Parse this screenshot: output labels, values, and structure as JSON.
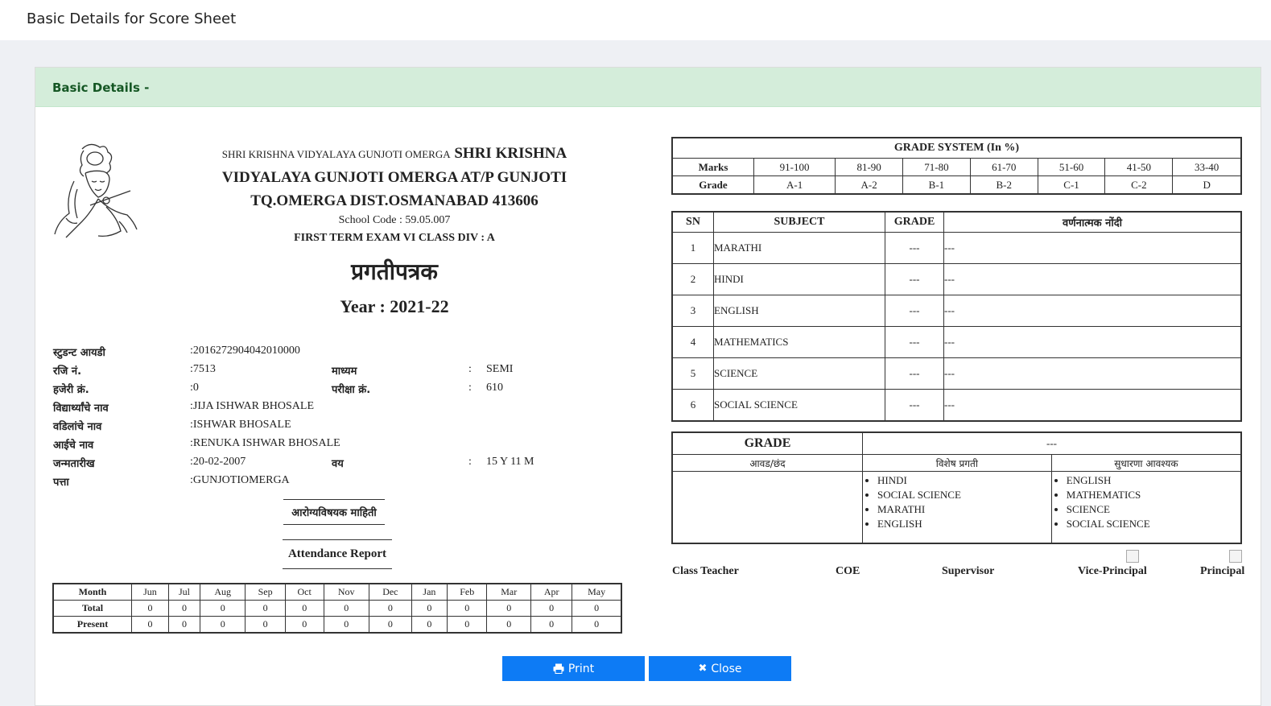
{
  "page": {
    "title": "Basic Details for Score Sheet"
  },
  "card": {
    "header": "Basic Details -"
  },
  "school": {
    "line1_small": "SHRI KRISHNA VIDYALAYA GUNJOTI OMERGA",
    "line1_big": "SHRI KRISHNA",
    "line2": "VIDYALAYA GUNJOTI OMERGA AT/P GUNJOTI",
    "line3": "TQ.OMERGA DIST.OSMANABAD 413606",
    "school_code": "School Code : 59.05.007",
    "exam": "FIRST TERM EXAM VI CLASS DIV : A",
    "report_title": "प्रगतीपत्रक",
    "year": "Year : 2021-22"
  },
  "student": {
    "rows": [
      {
        "label": "स्टुडन्ट आयडी",
        "value": ":2016272904042010000"
      },
      {
        "label": "रजि नं.",
        "value": ":7513",
        "label2": "माध्यम",
        "value2": "SEMI"
      },
      {
        "label": "हजेरी क्रं.",
        "value": ":0",
        "label2": "परीक्षा क्रं.",
        "value2": "610"
      },
      {
        "label": "विद्यार्थ्यांचे नाव",
        "value": ":JIJA ISHWAR BHOSALE"
      },
      {
        "label": "वडिलांचे नाव",
        "value": ":ISHWAR BHOSALE"
      },
      {
        "label": "आईचे नाव",
        "value": ":RENUKA ISHWAR BHOSALE"
      },
      {
        "label": "जन्मतारीख",
        "value": ":20-02-2007",
        "label2": "वय",
        "value2": "15 Y 11 M"
      },
      {
        "label": "पत्ता",
        "value": ":GUNJOTIOMERGA"
      }
    ],
    "colon": ":"
  },
  "health": {
    "title": "आरोग्यविषयक माहिती"
  },
  "attendance": {
    "title": "Attendance Report",
    "month_label": "Month",
    "total_label": "Total",
    "present_label": "Present",
    "months": [
      "Jun",
      "Jul",
      "Aug",
      "Sep",
      "Oct",
      "Nov",
      "Dec",
      "Jan",
      "Feb",
      "Mar",
      "Apr",
      "May"
    ],
    "total": [
      "0",
      "0",
      "0",
      "0",
      "0",
      "0",
      "0",
      "0",
      "0",
      "0",
      "0",
      "0"
    ],
    "present": [
      "0",
      "0",
      "0",
      "0",
      "0",
      "0",
      "0",
      "0",
      "0",
      "0",
      "0",
      "0"
    ]
  },
  "grade_system": {
    "title": "GRADE SYSTEM (In %)",
    "marks_label": "Marks",
    "grade_label": "Grade",
    "marks": [
      "91-100",
      "81-90",
      "71-80",
      "61-70",
      "51-60",
      "41-50",
      "33-40"
    ],
    "grades": [
      "A-1",
      "A-2",
      "B-1",
      "B-2",
      "C-1",
      "C-2",
      "D"
    ]
  },
  "subjects": {
    "headers": {
      "sn": "SN",
      "subject": "SUBJECT",
      "grade": "GRADE",
      "remark": "वर्णनात्मक नोंदी"
    },
    "rows": [
      {
        "sn": "1",
        "subject": "MARATHI",
        "grade": "---",
        "remark": "---"
      },
      {
        "sn": "2",
        "subject": "HINDI",
        "grade": "---",
        "remark": "---"
      },
      {
        "sn": "3",
        "subject": "ENGLISH",
        "grade": "---",
        "remark": "---"
      },
      {
        "sn": "4",
        "subject": "MATHEMATICS",
        "grade": "---",
        "remark": "---"
      },
      {
        "sn": "5",
        "subject": "SCIENCE",
        "grade": "---",
        "remark": "---"
      },
      {
        "sn": "6",
        "subject": "SOCIAL SCIENCE",
        "grade": "---",
        "remark": "---"
      }
    ]
  },
  "summary": {
    "grade_label": "GRADE",
    "grade_value": "---",
    "col1": "आवड/छंद",
    "col2": "विशेष प्रगती",
    "col3": "सुधारणा आवश्यक",
    "special_progress": [
      "HINDI",
      "SOCIAL SCIENCE",
      "MARATHI",
      "ENGLISH"
    ],
    "needs_improvement": [
      "ENGLISH",
      "MATHEMATICS",
      "SCIENCE",
      "SOCIAL SCIENCE"
    ]
  },
  "signatures": {
    "class_teacher": "Class Teacher",
    "coe": "COE",
    "supervisor": "Supervisor",
    "vice_principal": "Vice-Principal",
    "principal": "Principal"
  },
  "buttons": {
    "print": "Print",
    "close": "Close"
  },
  "colors": {
    "header_bg": "#d4edda",
    "header_text": "#155724",
    "button": "#0d7bf5"
  }
}
